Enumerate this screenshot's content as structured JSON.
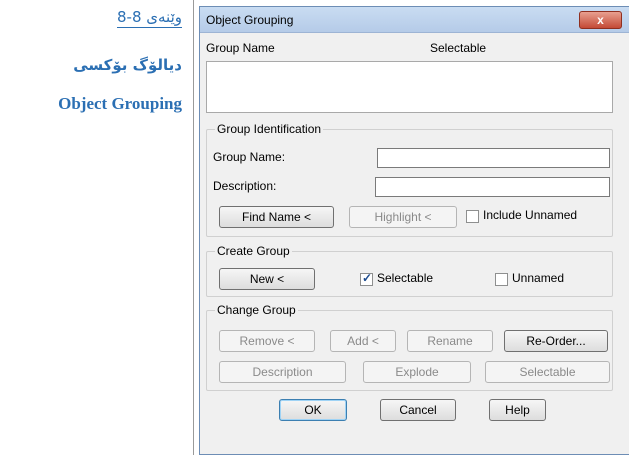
{
  "caption": {
    "line1": "وێنەی 8-8",
    "line2": "دیالۆگ بۆکسی",
    "line3": "Object Grouping"
  },
  "dialog": {
    "title": "Object Grouping",
    "close_label": "x",
    "columns": {
      "group_name": "Group Name",
      "selectable": "Selectable"
    },
    "group_identification": {
      "title": "Group Identification",
      "group_name_label": "Group Name:",
      "group_name_value": "",
      "description_label": "Description:",
      "description_value": "",
      "find_name": "Find Name <",
      "highlight": "Highlight <",
      "include_unnamed": "Include Unnamed",
      "include_unnamed_checked": false
    },
    "create_group": {
      "title": "Create Group",
      "new": "New <",
      "selectable": "Selectable",
      "selectable_checked": true,
      "unnamed": "Unnamed",
      "unnamed_checked": false
    },
    "change_group": {
      "title": "Change Group",
      "remove": "Remove <",
      "add": "Add <",
      "rename": "Rename",
      "reorder": "Re-Order...",
      "description": "Description",
      "explode": "Explode",
      "selectable": "Selectable"
    },
    "buttons": {
      "ok": "OK",
      "cancel": "Cancel",
      "help": "Help"
    }
  }
}
